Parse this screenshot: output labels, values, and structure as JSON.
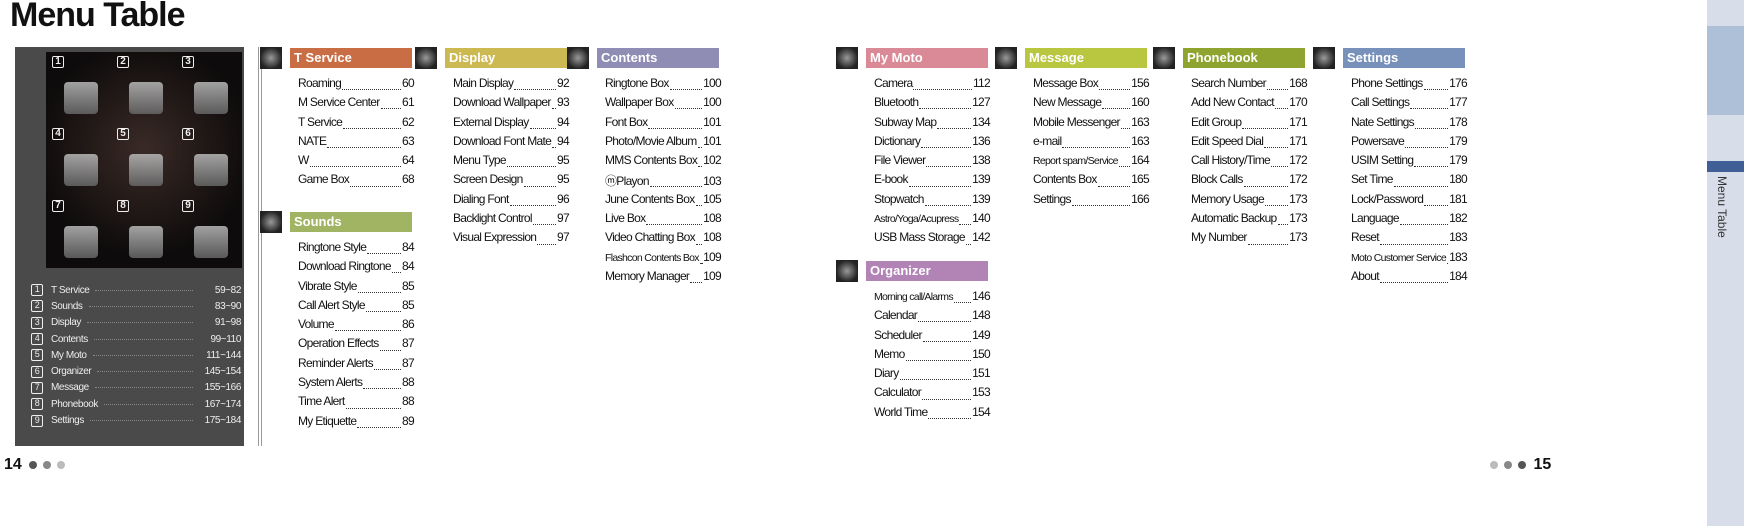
{
  "title": "Menu Table",
  "phone_screen": {
    "cells": [
      "1",
      "2",
      "3",
      "4",
      "5",
      "6",
      "7",
      "8",
      "9"
    ]
  },
  "legend": [
    {
      "n": "1",
      "label": "T Service",
      "pages": "59~82"
    },
    {
      "n": "2",
      "label": "Sounds",
      "pages": "83~90"
    },
    {
      "n": "3",
      "label": "Display",
      "pages": "91~98"
    },
    {
      "n": "4",
      "label": "Contents",
      "pages": "99~110"
    },
    {
      "n": "5",
      "label": "My Moto",
      "pages": "111~144"
    },
    {
      "n": "6",
      "label": "Organizer",
      "pages": "145~154"
    },
    {
      "n": "7",
      "label": "Message",
      "pages": "155~166"
    },
    {
      "n": "8",
      "label": "Phonebook",
      "pages": "167~174"
    },
    {
      "n": "9",
      "label": "Settings",
      "pages": "175~184"
    }
  ],
  "sections": [
    {
      "title": "T Service",
      "color": "#c96d44",
      "items": [
        [
          "Roaming",
          "60"
        ],
        [
          "M Service Center",
          "61"
        ],
        [
          "T Service",
          "62"
        ],
        [
          "NATE",
          "63"
        ],
        [
          "W",
          "64"
        ],
        [
          "Game Box",
          "68"
        ]
      ]
    },
    {
      "title": "Sounds",
      "color": "#a1b463",
      "items": [
        [
          "Ringtone Style",
          "84"
        ],
        [
          "Download Ringtone",
          "84"
        ],
        [
          "Vibrate Style",
          "85"
        ],
        [
          "Call Alert Style",
          "85"
        ],
        [
          "Volume",
          "86"
        ],
        [
          "Operation Effects",
          "87"
        ],
        [
          "Reminder Alerts",
          "87"
        ],
        [
          "System Alerts",
          "88"
        ],
        [
          "Time Alert",
          "88"
        ],
        [
          "My Etiquette",
          "89"
        ]
      ]
    },
    {
      "title": "Display",
      "color": "#cdb952",
      "items": [
        [
          "Main Display",
          "92"
        ],
        [
          "Download Wallpaper",
          "93"
        ],
        [
          "External Display",
          "94"
        ],
        [
          "Download Font Mate",
          "94"
        ],
        [
          "Menu Type",
          "95"
        ],
        [
          "Screen Design",
          "95"
        ],
        [
          "Dialing Font",
          "96"
        ],
        [
          "Backlight Control",
          "97"
        ],
        [
          "Visual Expression",
          "97"
        ]
      ]
    },
    {
      "title": "Contents",
      "color": "#8f8db4",
      "items": [
        [
          "Ringtone Box",
          "100"
        ],
        [
          "Wallpaper Box",
          "100"
        ],
        [
          "Font Box",
          "101"
        ],
        [
          "Photo/Movie Album",
          "101"
        ],
        [
          "MMS Contents Box",
          "102"
        ],
        [
          "ⓜPlayon",
          "103"
        ],
        [
          "June Contents Box",
          "105"
        ],
        [
          "Live Box",
          "108"
        ],
        [
          "Video Chatting Box",
          "108"
        ],
        [
          "Flashcon Contents Box",
          "109"
        ],
        [
          "Memory Manager",
          "109"
        ]
      ]
    },
    {
      "title": "My Moto",
      "color": "#d98a96",
      "items": [
        [
          "Camera",
          "112"
        ],
        [
          "Bluetooth",
          "127"
        ],
        [
          "Subway Map",
          "134"
        ],
        [
          "Dictionary",
          "136"
        ],
        [
          "File Viewer",
          "138"
        ],
        [
          "E-book",
          "139"
        ],
        [
          "Stopwatch",
          "139"
        ],
        [
          "Astro/Yoga/Acupress",
          "140"
        ],
        [
          "USB Mass Storage",
          "142"
        ]
      ]
    },
    {
      "title": "Organizer",
      "color": "#b283b5",
      "items": [
        [
          "Morning call/Alarms",
          "146"
        ],
        [
          "Calendar",
          "148"
        ],
        [
          "Scheduler",
          "149"
        ],
        [
          "Memo",
          "150"
        ],
        [
          "Diary",
          "151"
        ],
        [
          "Calculator",
          "153"
        ],
        [
          "World Time",
          "154"
        ]
      ]
    },
    {
      "title": "Message",
      "color": "#b8c640",
      "items": [
        [
          "Message Box",
          "156"
        ],
        [
          "New Message",
          "160"
        ],
        [
          "Mobile Messenger",
          "163"
        ],
        [
          "e-mail",
          "163"
        ],
        [
          "Report spam/Service",
          "164"
        ],
        [
          "Contents Box",
          "165"
        ],
        [
          "Settings",
          "166"
        ]
      ]
    },
    {
      "title": "Phonebook",
      "color": "#8ea42e",
      "items": [
        [
          "Search Number",
          "168"
        ],
        [
          "Add New Contact",
          "170"
        ],
        [
          "Edit Group",
          "171"
        ],
        [
          "Edit Speed Dial",
          "171"
        ],
        [
          "Call History/Time",
          "172"
        ],
        [
          "Block Calls",
          "172"
        ],
        [
          "Memory Usage",
          "173"
        ],
        [
          "Automatic Backup",
          "173"
        ],
        [
          "My Number",
          "173"
        ]
      ]
    },
    {
      "title": "Settings",
      "color": "#7891bb",
      "items": [
        [
          "Phone Settings",
          "176"
        ],
        [
          "Call Settings",
          "177"
        ],
        [
          "Nate Settings",
          "178"
        ],
        [
          "Powersave",
          "179"
        ],
        [
          "USIM Setting",
          "179"
        ],
        [
          "Set Time",
          "180"
        ],
        [
          "Lock/Password",
          "181"
        ],
        [
          "Language",
          "182"
        ],
        [
          "Reset",
          "183"
        ],
        [
          "Moto Customer Service",
          "183"
        ],
        [
          "About",
          "184"
        ]
      ]
    }
  ],
  "footer": {
    "left_page": "14",
    "right_page": "15"
  },
  "side_tab": "Menu Table"
}
